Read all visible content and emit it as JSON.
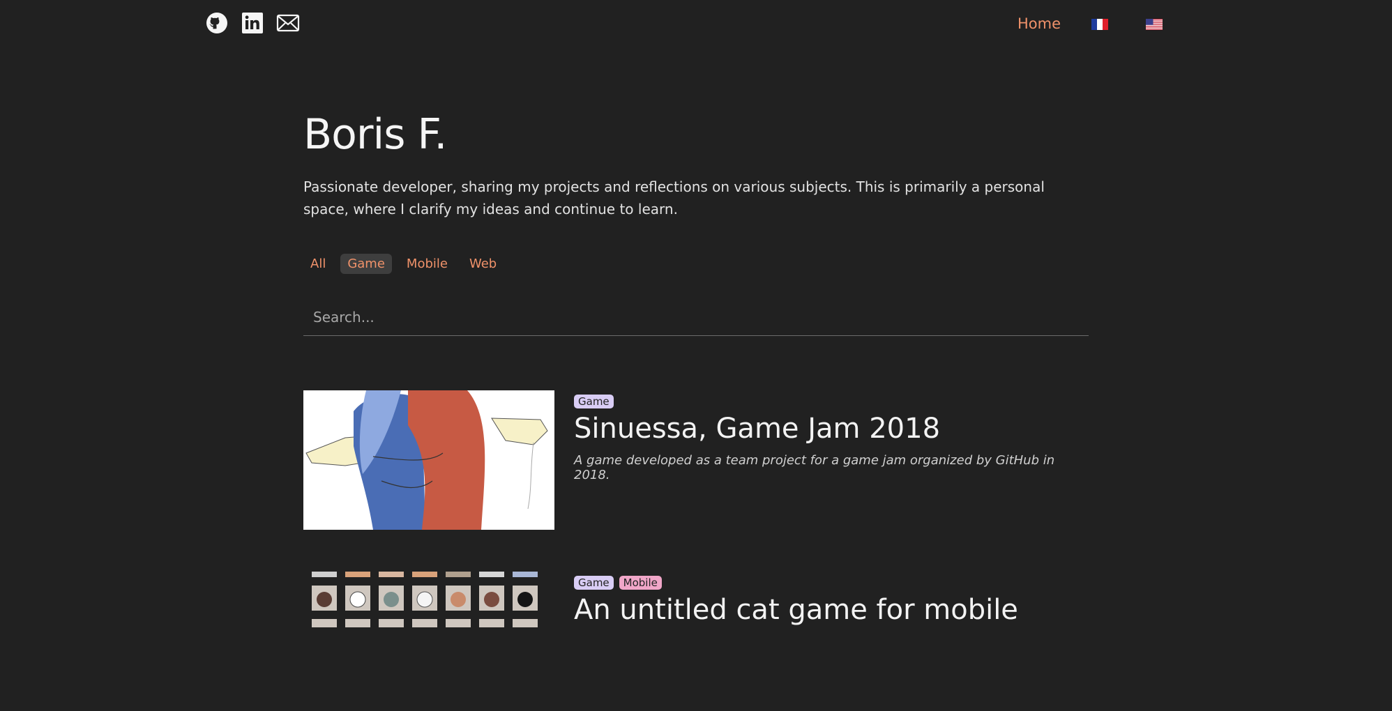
{
  "nav": {
    "home_label": "Home",
    "social_icons": [
      "github-icon",
      "linkedin-icon",
      "mail-icon"
    ],
    "languages": [
      "fr-flag",
      "us-flag"
    ]
  },
  "header": {
    "title": "Boris F.",
    "intro": "Passionate developer, sharing my projects and reflections on various subjects. This is primarily a personal space, where I clarify my ideas and continue to learn."
  },
  "filters": {
    "items": [
      "All",
      "Game",
      "Mobile",
      "Web"
    ],
    "active": "Game"
  },
  "search": {
    "placeholder": "Search..."
  },
  "projects": [
    {
      "tags": [
        "Game"
      ],
      "title": "Sinuessa, Game Jam 2018",
      "description": "A game developed as a team project for a game jam organized by GitHub in 2018."
    },
    {
      "tags": [
        "Game",
        "Mobile"
      ],
      "title": "An untitled cat game for mobile",
      "description": ""
    }
  ],
  "colors": {
    "background": "#212121",
    "accent": "#f0926a",
    "tag_game": "#d9cdf5",
    "tag_mobile": "#f0a6c8"
  }
}
